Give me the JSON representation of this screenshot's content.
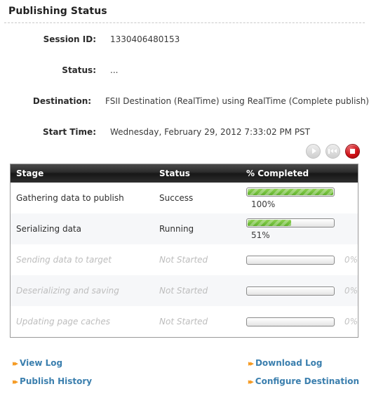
{
  "page": {
    "title": "Publishing Status"
  },
  "info": {
    "rows": [
      {
        "label": "Session ID:",
        "value": "1330406480153"
      },
      {
        "label": "Status:",
        "value": "..."
      },
      {
        "label": "Destination:",
        "value": "FSII Destination (RealTime) using RealTime (Complete publish)"
      },
      {
        "label": "Start Time:",
        "value": "Wednesday, February 29, 2012 7:33:02 PM PST"
      }
    ]
  },
  "controls": {
    "play": {
      "name": "play-button",
      "icon": "play-icon",
      "enabled": false
    },
    "rewind": {
      "name": "rewind-button",
      "icon": "rewind-icon",
      "enabled": false
    },
    "stop": {
      "name": "stop-button",
      "icon": "stop-icon",
      "enabled": true,
      "color": "#cf1117"
    }
  },
  "table": {
    "headers": {
      "stage": "Stage",
      "status": "Status",
      "completed": "% Completed"
    },
    "rows": [
      {
        "stage": "Gathering data to publish",
        "status": "Success",
        "percent": "100%",
        "value": 100,
        "state": "done"
      },
      {
        "stage": "Serializing data",
        "status": "Running",
        "percent": "51%",
        "value": 51,
        "state": "running"
      },
      {
        "stage": "Sending data to target",
        "status": "Not Started",
        "percent": "0%",
        "value": 0,
        "state": "pending"
      },
      {
        "stage": "Deserializing and saving",
        "status": "Not Started",
        "percent": "0%",
        "value": 0,
        "state": "pending"
      },
      {
        "stage": "Updating page caches",
        "status": "Not Started",
        "percent": "0%",
        "value": 0,
        "state": "pending"
      }
    ]
  },
  "links": {
    "view_log": "View Log",
    "download_log": "Download Log",
    "publish_history": "Publish History",
    "configure_destination": "Configure Destination",
    "accent_color": "#3b7fae",
    "bullet_color": "#f59a22"
  }
}
